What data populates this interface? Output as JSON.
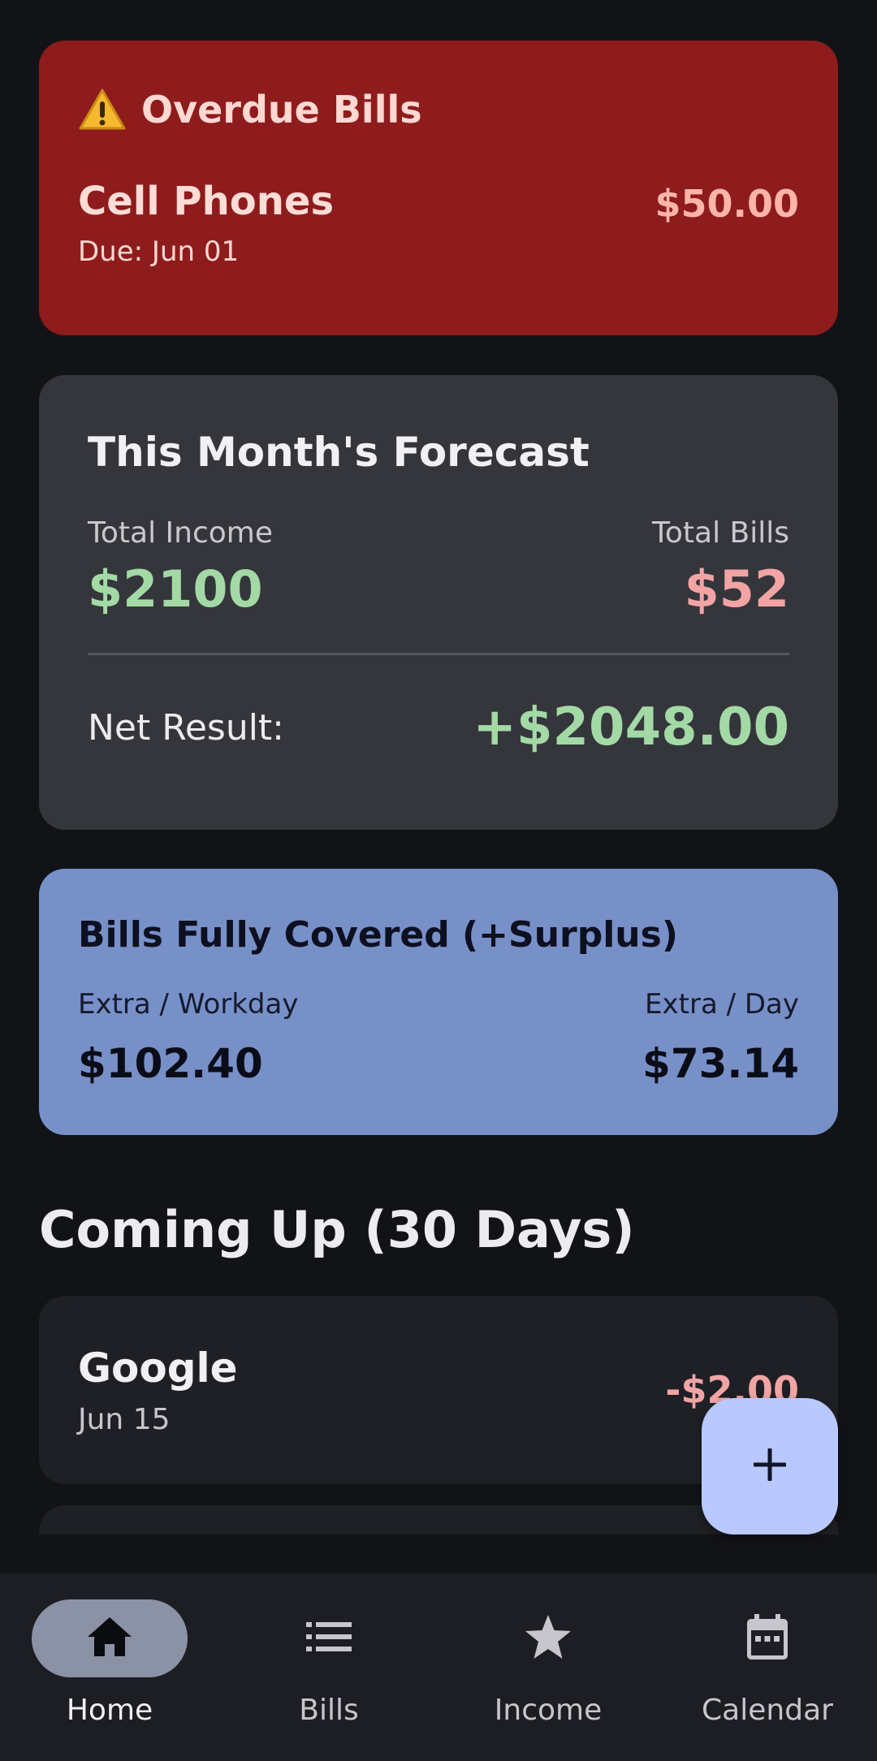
{
  "overdue": {
    "icon": "warning-icon",
    "title": "Overdue Bills",
    "bill_name": "Cell Phones",
    "amount": "$50.00",
    "due": "Due: Jun 01",
    "color": "#8e1c1c"
  },
  "forecast": {
    "title": "This Month's Forecast",
    "income_label": "Total Income",
    "income_value": "$2100",
    "bills_label": "Total Bills",
    "bills_value": "$52",
    "net_label": "Net Result:",
    "net_value": "+$2048.00",
    "positive_color": "#a3d9a5",
    "negative_color": "#f2a4a4"
  },
  "covered": {
    "title": "Bills Fully Covered (+Surplus)",
    "workday_label": "Extra / Workday",
    "workday_value": "$102.40",
    "day_label": "Extra / Day",
    "day_value": "$73.14",
    "color": "#7890c8"
  },
  "upcoming": {
    "section_title": "Coming Up (30 Days)",
    "items": [
      {
        "name": "Google",
        "date": "Jun 15",
        "amount": "-$2.00"
      }
    ]
  },
  "fab": {
    "icon": "plus-icon",
    "color": "#b9c8ff"
  },
  "nav": {
    "items": [
      {
        "label": "Home",
        "icon": "home-icon",
        "active": true
      },
      {
        "label": "Bills",
        "icon": "list-icon",
        "active": false
      },
      {
        "label": "Income",
        "icon": "star-icon",
        "active": false
      },
      {
        "label": "Calendar",
        "icon": "calendar-icon",
        "active": false
      }
    ]
  }
}
